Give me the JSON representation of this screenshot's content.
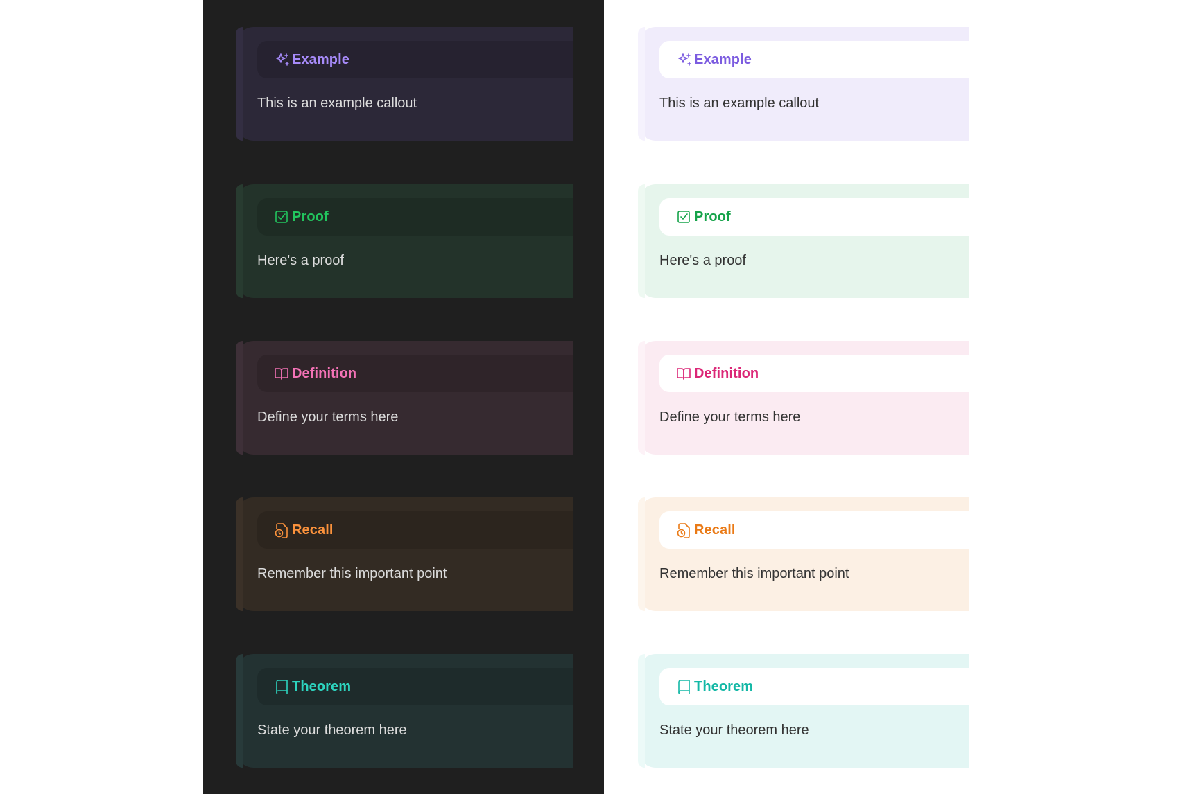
{
  "dark": {
    "callouts": [
      {
        "title": "Example",
        "body": "This is an example callout",
        "icon": "sparkles-icon",
        "accent": "#a78bfa",
        "bg": "#2c2838",
        "edge": "#332e42"
      },
      {
        "title": "Proof",
        "body": "Here's a proof",
        "icon": "square-check-icon",
        "accent": "#22c55e",
        "bg": "#23332a",
        "edge": "#283b30"
      },
      {
        "title": "Definition",
        "body": "Define your terms here",
        "icon": "book-open-icon",
        "accent": "#f472b6",
        "bg": "#362a30",
        "edge": "#3e3038"
      },
      {
        "title": "Recall",
        "body": "Remember this important point",
        "icon": "file-clock-icon",
        "accent": "#fb923c",
        "bg": "#332b23",
        "edge": "#3b3128"
      },
      {
        "title": "Theorem",
        "body": "State your theorem here",
        "icon": "book-icon",
        "accent": "#2dd4bf",
        "bg": "#233232",
        "edge": "#283a3a"
      }
    ]
  },
  "light": {
    "callouts": [
      {
        "title": "Example",
        "body": "This is an example callout",
        "icon": "sparkles-icon",
        "accent": "#7c5ce0",
        "bg": "#f0ecfb",
        "edge": "#f5f2fd"
      },
      {
        "title": "Proof",
        "body": "Here's a proof",
        "icon": "square-check-icon",
        "accent": "#16a34a",
        "bg": "#e6f5ec",
        "edge": "#eef9f2"
      },
      {
        "title": "Definition",
        "body": "Define your terms here",
        "icon": "book-open-icon",
        "accent": "#db2777",
        "bg": "#fbebf2",
        "edge": "#fdf2f7"
      },
      {
        "title": "Recall",
        "body": "Remember this important point",
        "icon": "file-clock-icon",
        "accent": "#ea7a16",
        "bg": "#fcf0e4",
        "edge": "#fdf5ec"
      },
      {
        "title": "Theorem",
        "body": "State your theorem here",
        "icon": "book-icon",
        "accent": "#14b8a6",
        "bg": "#e3f6f4",
        "edge": "#ecfaf8"
      }
    ]
  }
}
